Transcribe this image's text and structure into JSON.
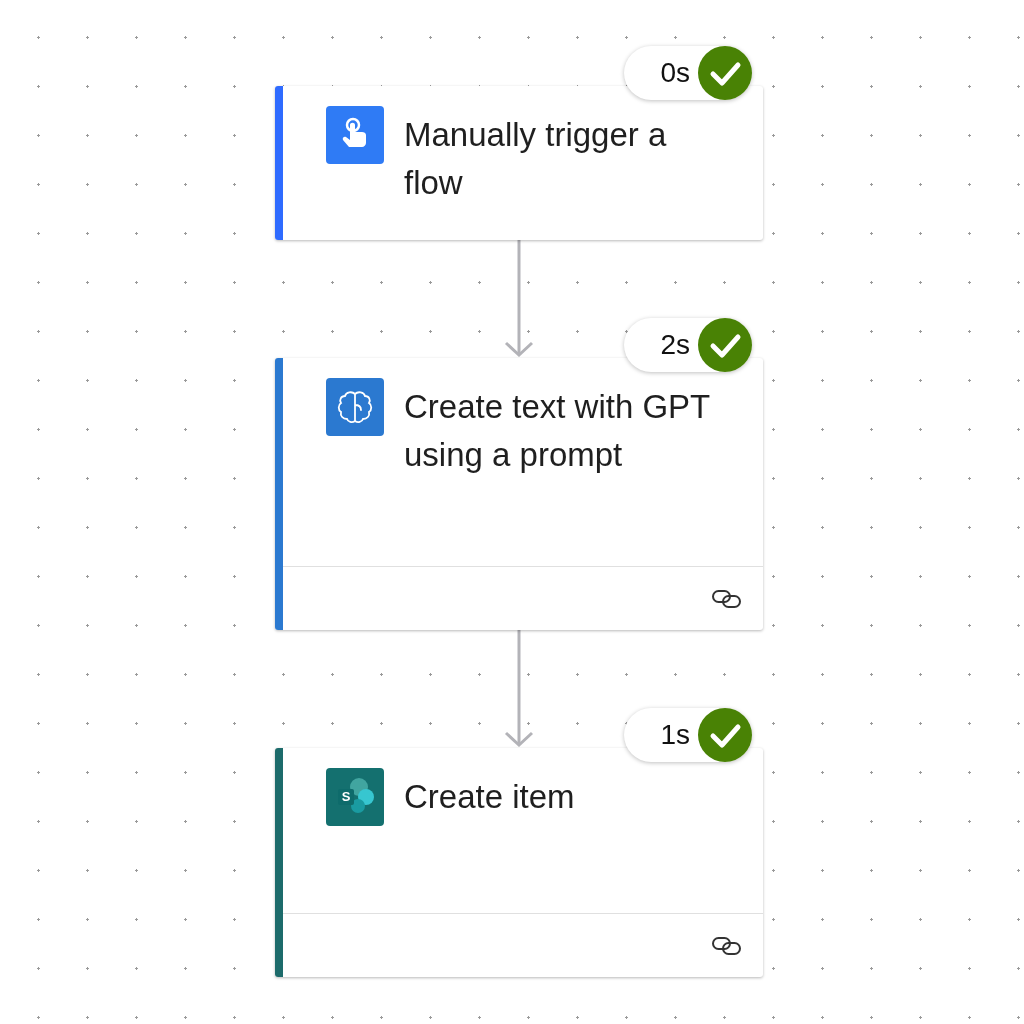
{
  "steps": [
    {
      "kind": "trigger",
      "title": "Manually trigger a flow",
      "succeeded": true,
      "duration": "0s",
      "connection": false
    },
    {
      "kind": "ai",
      "title": "Create text with GPT using a prompt",
      "succeeded": true,
      "duration": "2s",
      "connection": true
    },
    {
      "kind": "sharepoint",
      "icon_letter": "S",
      "title": "Create item",
      "succeeded": true,
      "duration": "1s",
      "connection": true
    }
  ]
}
